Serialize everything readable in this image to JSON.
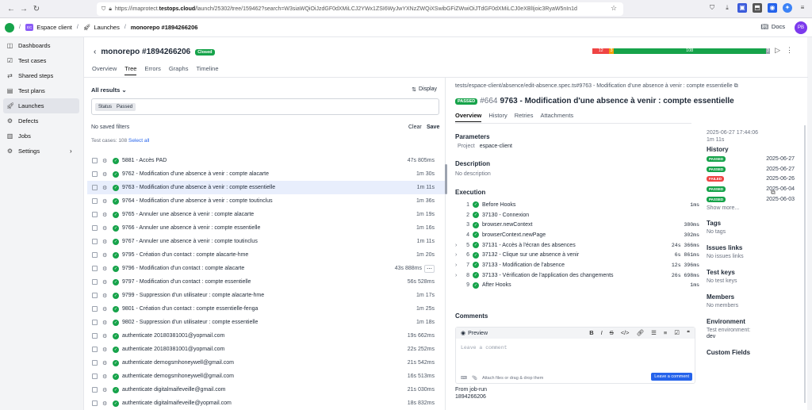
{
  "browser": {
    "url_prefix": "https://imaprotect.",
    "url_domain": "testops.cloud",
    "url_suffix": "/launch/25302/tree/159462?search=W3siaWQiOiJzdGF0dXMiLCJ2YWx1ZSI6WyJwYXNzZWQiXSwibGFiZWwiOiJTdGF0dXMiLCJ0eXBlIjoic3RyaW5nIn1d"
  },
  "app": {
    "project": "Espace client",
    "project_abbr": "EC",
    "launches_label": "Launches",
    "current_crumb": "monorepo #1894266206",
    "docs_label": "Docs",
    "avatar": "PB"
  },
  "sidebar": {
    "items": [
      {
        "label": "Dashboards",
        "icon": "dashboard-icon"
      },
      {
        "label": "Test cases",
        "icon": "testcases-icon"
      },
      {
        "label": "Shared steps",
        "icon": "shared-steps-icon"
      },
      {
        "label": "Test plans",
        "icon": "testplans-icon"
      },
      {
        "label": "Launches",
        "icon": "rocket-icon"
      },
      {
        "label": "Defects",
        "icon": "bug-icon"
      },
      {
        "label": "Jobs",
        "icon": "jobs-icon"
      },
      {
        "label": "Settings",
        "icon": "gear-icon"
      }
    ]
  },
  "launch": {
    "title": "monorepo #1894266206",
    "status": "Closed",
    "tabs": [
      "Overview",
      "Tree",
      "Errors",
      "Graphs",
      "Timeline"
    ],
    "active_tab": "Tree",
    "progress": [
      {
        "label": "12",
        "color": "#ef4444",
        "value": 12
      },
      {
        "label": "3",
        "color": "#f59e0b",
        "value": 3
      },
      {
        "label": "108",
        "color": "#16a34a",
        "value": 108
      },
      {
        "label": "3",
        "color": "#9ca3af",
        "value": 3
      }
    ]
  },
  "tree": {
    "results_label": "All results",
    "display_label": "Display",
    "filter_key": "Status",
    "filter_value": "Passed",
    "no_saved": "No saved filters",
    "clear": "Clear",
    "save": "Save",
    "count_label": "Test cases: 108",
    "select_all": "Select all",
    "rows": [
      {
        "name": "5881 - Accès PAD",
        "dur": "47s 805ms"
      },
      {
        "name": "9762 - Modification d'une absence à venir : compte alacarte",
        "dur": "1m 30s"
      },
      {
        "name": "9763 - Modification d'une absence à venir : compte essentielle",
        "dur": "1m 11s"
      },
      {
        "name": "9764 - Modification d'une absence à venir : compte toutinclus",
        "dur": "1m 36s"
      },
      {
        "name": "9765 - Annuler une absence à venir : compte alacarte",
        "dur": "1m 19s"
      },
      {
        "name": "9766 - Annuler une absence à venir : compte essentielle",
        "dur": "1m 16s"
      },
      {
        "name": "9767 - Annuler une absence à venir : compte toutinclus",
        "dur": "1m 11s"
      },
      {
        "name": "9795 - Création d'un contact : compte alacarte-hme",
        "dur": "1m 20s"
      },
      {
        "name": "9796 - Modification d'un contact : compte alacarte",
        "dur": "43s 888ms"
      },
      {
        "name": "9797 - Modification d'un contact : compte essentielle",
        "dur": "56s 528ms"
      },
      {
        "name": "9799 - Suppression d'un utilisateur : compte alacarte-hme",
        "dur": "1m 17s"
      },
      {
        "name": "9801 - Création d'un contact : compte essentielle-fenga",
        "dur": "1m 25s"
      },
      {
        "name": "9802 - Suppression d'un utilisateur : compte essentielle",
        "dur": "1m 18s"
      },
      {
        "name": "authenticate 20180381001@yopmail.com",
        "dur": "19s 662ms"
      },
      {
        "name": "authenticate 20180381001@yopmail.com",
        "dur": "22s 252ms"
      },
      {
        "name": "authenticate demogsmhoneywell@gmail.com",
        "dur": "21s 542ms"
      },
      {
        "name": "authenticate demogsmhoneywell@gmail.com",
        "dur": "16s 513ms"
      },
      {
        "name": "authenticate digitalmaifeveille@gmail.com",
        "dur": "21s 030ms"
      },
      {
        "name": "authenticate digitalmaifeveille@yopmail.com",
        "dur": "18s 832ms"
      }
    ]
  },
  "detail": {
    "path": "tests/espace-client/absence/edit-absence.spec.ts#9763 - Modification d'une absence à venir : compte essentielle",
    "status": "PASSED",
    "id": "#664",
    "title": "9763 - Modification d'une absence à venir : compte essentielle",
    "tabs": [
      "Overview",
      "History",
      "Retries",
      "Attachments"
    ],
    "params_title": "Parameters",
    "param_key": "Project",
    "param_value": "espace-client",
    "desc_title": "Description",
    "desc_value": "No description",
    "exec_title": "Execution",
    "steps": [
      {
        "n": "1",
        "label": "Before Hooks",
        "time": "1ms",
        "arrow": ""
      },
      {
        "n": "2",
        "label": "37130 - Connexion",
        "time": "",
        "arrow": ""
      },
      {
        "n": "3",
        "label": "browser.newContext",
        "time": "380ms",
        "arrow": ""
      },
      {
        "n": "4",
        "label": "browserContext.newPage",
        "time": "302ms",
        "arrow": ""
      },
      {
        "n": "5",
        "label": "37131 - Accès à l'écran des absences",
        "time": "24s 366ms",
        "arrow": "›"
      },
      {
        "n": "6",
        "label": "37132 - Clique sur une absence à venir",
        "time": "6s 861ms",
        "arrow": "›"
      },
      {
        "n": "7",
        "label": "37133 - Modification de l'absence",
        "time": "12s 396ms",
        "arrow": "›"
      },
      {
        "n": "8",
        "label": "37133 - Vérification de l'application des changements",
        "time": "26s 698ms",
        "arrow": "›"
      },
      {
        "n": "9",
        "label": "After Hooks",
        "time": "1ms",
        "arrow": ""
      }
    ],
    "comments_title": "Comments",
    "preview_label": "Preview",
    "comment_placeholder": "Leave a comment",
    "attach_label": "Attach files or drag & drop them",
    "comment_button": "Leave a comment",
    "from_label": "From job-run",
    "from_value": "1894266206",
    "side": {
      "date": "2025-06-27 17:44:06",
      "duration": "1m 11s",
      "history_title": "History",
      "history": [
        {
          "status": "PASSED",
          "date": "2025-06-27",
          "color": "#16a34a"
        },
        {
          "status": "PASSED",
          "date": "2025-06-27",
          "color": "#16a34a"
        },
        {
          "status": "FAILED",
          "date": "2025-06-26",
          "color": "#ef4444"
        },
        {
          "status": "PASSED",
          "date": "2025-06-04",
          "color": "#16a34a"
        },
        {
          "status": "PASSED",
          "date": "2025-06-03",
          "color": "#16a34a"
        }
      ],
      "show_more": "Show more...",
      "tags_title": "Tags",
      "tags_value": "No tags",
      "issues_title": "Issues links",
      "issues_value": "No issues links",
      "keys_title": "Test keys",
      "keys_value": "No test keys",
      "members_title": "Members",
      "members_value": "No members",
      "env_title": "Environment",
      "env_label": "Test environment:",
      "env_value": "dev",
      "custom_title": "Custom Fields"
    }
  }
}
